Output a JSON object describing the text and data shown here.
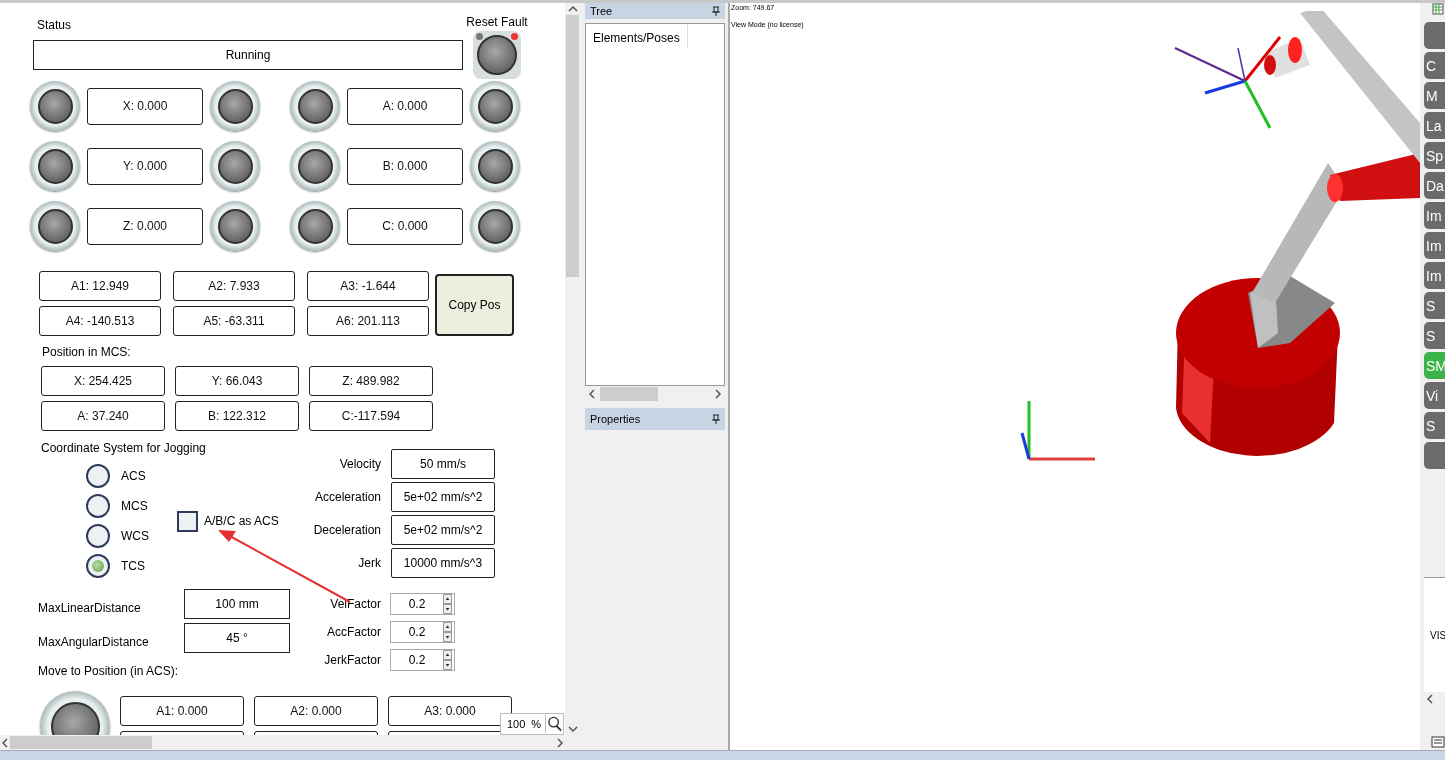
{
  "status": {
    "label": "Status",
    "value": "Running"
  },
  "reset_fault": {
    "label": "Reset Fault"
  },
  "jog_axes": [
    {
      "label": "X: 0.000"
    },
    {
      "label": "A: 0.000"
    },
    {
      "label": "Y: 0.000"
    },
    {
      "label": "B: 0.000"
    },
    {
      "label": "Z: 0.000"
    },
    {
      "label": "C: 0.000"
    }
  ],
  "joint_positions": [
    "A1: 12.949",
    "A2: 7.933",
    "A3: -1.644",
    "A4: -140.513",
    "A5: -63.311",
    "A6: 201.113"
  ],
  "copy_button": "Copy Pos",
  "mcs": {
    "label": "Position in MCS:",
    "values": [
      "X: 254.425",
      "Y: 66.043",
      "Z: 489.982",
      "A: 37.240",
      "B: 122.312",
      "C:-117.594"
    ]
  },
  "coordinate_system": {
    "label": "Coordinate System for Jogging",
    "options": [
      {
        "label": "ACS",
        "selected": false
      },
      {
        "label": "MCS",
        "selected": false
      },
      {
        "label": "WCS",
        "selected": false
      },
      {
        "label": "TCS",
        "selected": true
      }
    ]
  },
  "abc_as_acs": {
    "label": "A/B/C as ACS",
    "checked": false
  },
  "motion": [
    {
      "label": "Velocity",
      "value": "50 mm/s"
    },
    {
      "label": "Acceleration",
      "value": "5e+02 mm/s^2"
    },
    {
      "label": "Deceleration",
      "value": "5e+02 mm/s^2"
    },
    {
      "label": "Jerk",
      "value": "10000 mm/s^3"
    }
  ],
  "distances": [
    {
      "label": "MaxLinearDistance",
      "value": "100 mm"
    },
    {
      "label": "MaxAngularDistance",
      "value": "45 °"
    }
  ],
  "factors": [
    {
      "label": "VelFactor",
      "value": "0.2"
    },
    {
      "label": "AccFactor",
      "value": "0.2"
    },
    {
      "label": "JerkFactor",
      "value": "0.2"
    }
  ],
  "move_to": {
    "label": "Move to Position (in ACS):",
    "values": [
      "A1: 0.000",
      "A2: 0.000",
      "A3: 0.000"
    ]
  },
  "zoom_box": {
    "value": "100",
    "unit": "%"
  },
  "tree_panel": {
    "title": "Tree",
    "tab": "Elements/Poses"
  },
  "properties_panel": {
    "title": "Properties"
  },
  "viewport": {
    "zoom": "Zoom: 749.67",
    "mode": "View Mode (no license)"
  },
  "right_toolbar": [
    {
      "selected": false
    },
    {
      "label": "C",
      "selected": false
    },
    {
      "label": "M",
      "selected": false
    },
    {
      "label": "La",
      "selected": false
    },
    {
      "label": "Sp",
      "selected": false
    },
    {
      "label": "Da",
      "selected": false
    },
    {
      "label": "Im",
      "selected": false
    },
    {
      "label": "Im",
      "selected": false
    },
    {
      "label": "Im",
      "selected": false
    },
    {
      "label": "S",
      "selected": false
    },
    {
      "label": "S",
      "selected": false
    },
    {
      "label": "SM",
      "selected": true
    },
    {
      "label": "Vi",
      "selected": false
    },
    {
      "label": "S",
      "selected": false
    },
    {
      "selected": false
    }
  ],
  "right_panel_text": "VIS"
}
